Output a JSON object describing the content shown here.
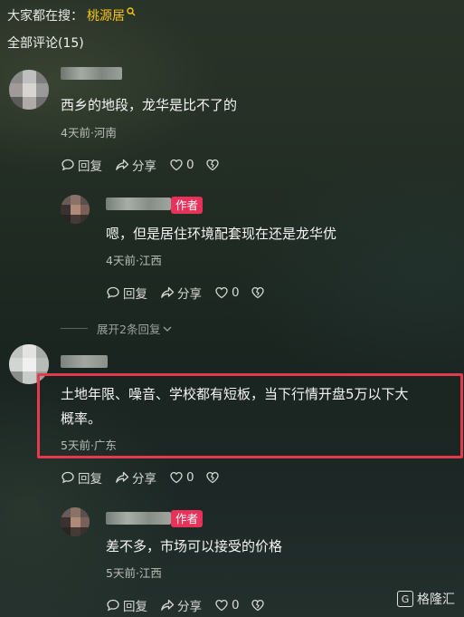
{
  "search": {
    "prefix": "大家都在搜：",
    "term": "桃源居"
  },
  "comments_header": "全部评论(15)",
  "comments": [
    {
      "text": "西乡的地段，龙华是比不了的",
      "meta": "4天前·河南",
      "reply_label": "回复",
      "share_label": "分享",
      "likes": "0",
      "reply": {
        "badge": "作者",
        "text": "嗯，但是居住环境配套现在还是龙华优",
        "meta": "4天前·江西",
        "reply_label": "回复",
        "share_label": "分享",
        "likes": "0"
      },
      "expand_label": "展开2条回复"
    },
    {
      "text_line1": "土地年限、噪音、学校都有短板，当下行情开盘5万以下大",
      "text_line2": "概率。",
      "meta": "5天前·广东",
      "reply_label": "回复",
      "share_label": "分享",
      "likes": "0",
      "reply": {
        "badge": "作者",
        "text": "差不多，市场可以接受的价格",
        "meta": "5天前·江西",
        "reply_label": "回复",
        "share_label": "分享",
        "likes": "0"
      }
    }
  ],
  "watermark": "格隆汇",
  "colors": {
    "accent_search": "#f5c518",
    "author_badge": "#e8325a",
    "highlight": "#e53a4e"
  }
}
